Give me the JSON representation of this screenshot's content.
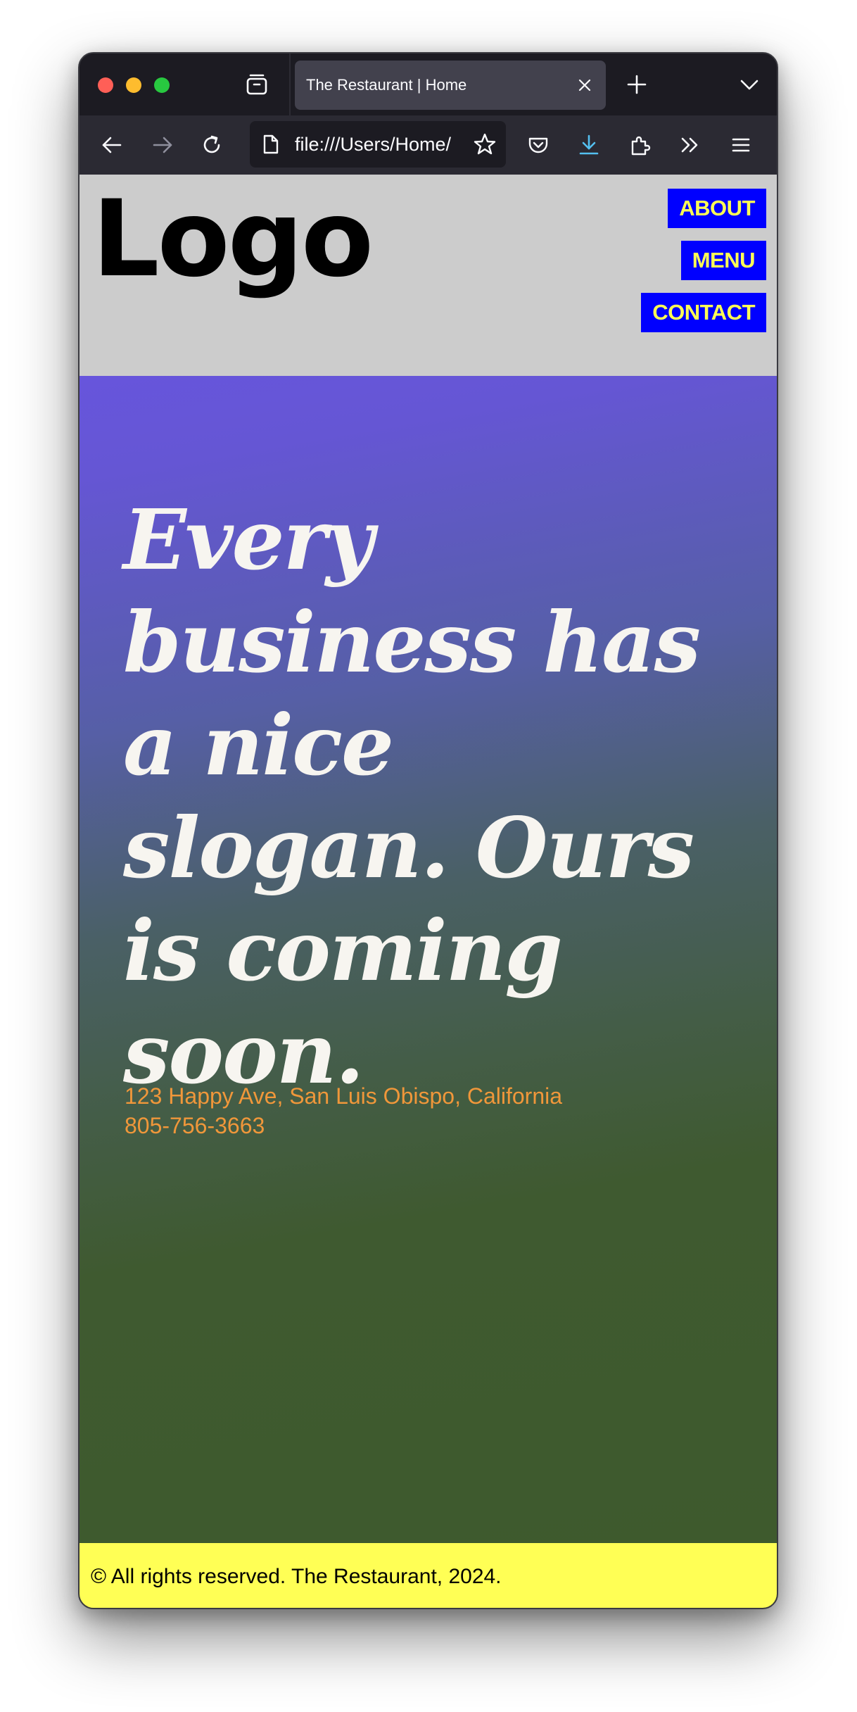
{
  "browser": {
    "tab_title": "The Restaurant | Home",
    "url": "file:///Users/Home/",
    "icons": {
      "tab_overview": "tab-overview-icon",
      "tab_close": "close-icon",
      "new_tab": "plus-icon",
      "tab_list": "chevron-down-icon",
      "back": "arrow-left-icon",
      "forward": "arrow-right-icon",
      "reload": "reload-icon",
      "page": "page-icon",
      "bookmark": "star-icon",
      "pocket": "pocket-icon",
      "downloads": "download-icon",
      "extensions": "puzzle-icon",
      "overflow": "double-chevron-icon",
      "menu": "hamburger-icon"
    }
  },
  "site": {
    "logo": "Logo",
    "nav": [
      "ABOUT",
      "MENU",
      "CONTACT"
    ],
    "slogan": "Every business has a nice slogan. Ours is coming soon.",
    "address": "123 Happy Ave, San Luis Obispo, California",
    "phone": "805-756-3663",
    "footer": "© All rights reserved. The Restaurant, 2024."
  },
  "colors": {
    "header_bg": "#cccccc",
    "nav_bg": "#0000ff",
    "nav_text": "#ffff55",
    "hero_top": "#6755dc",
    "hero_bottom": "#3e5a2d",
    "slogan_text": "#f7f5f0",
    "contact_text": "#f0973a",
    "footer_bg": "#ffff55"
  }
}
